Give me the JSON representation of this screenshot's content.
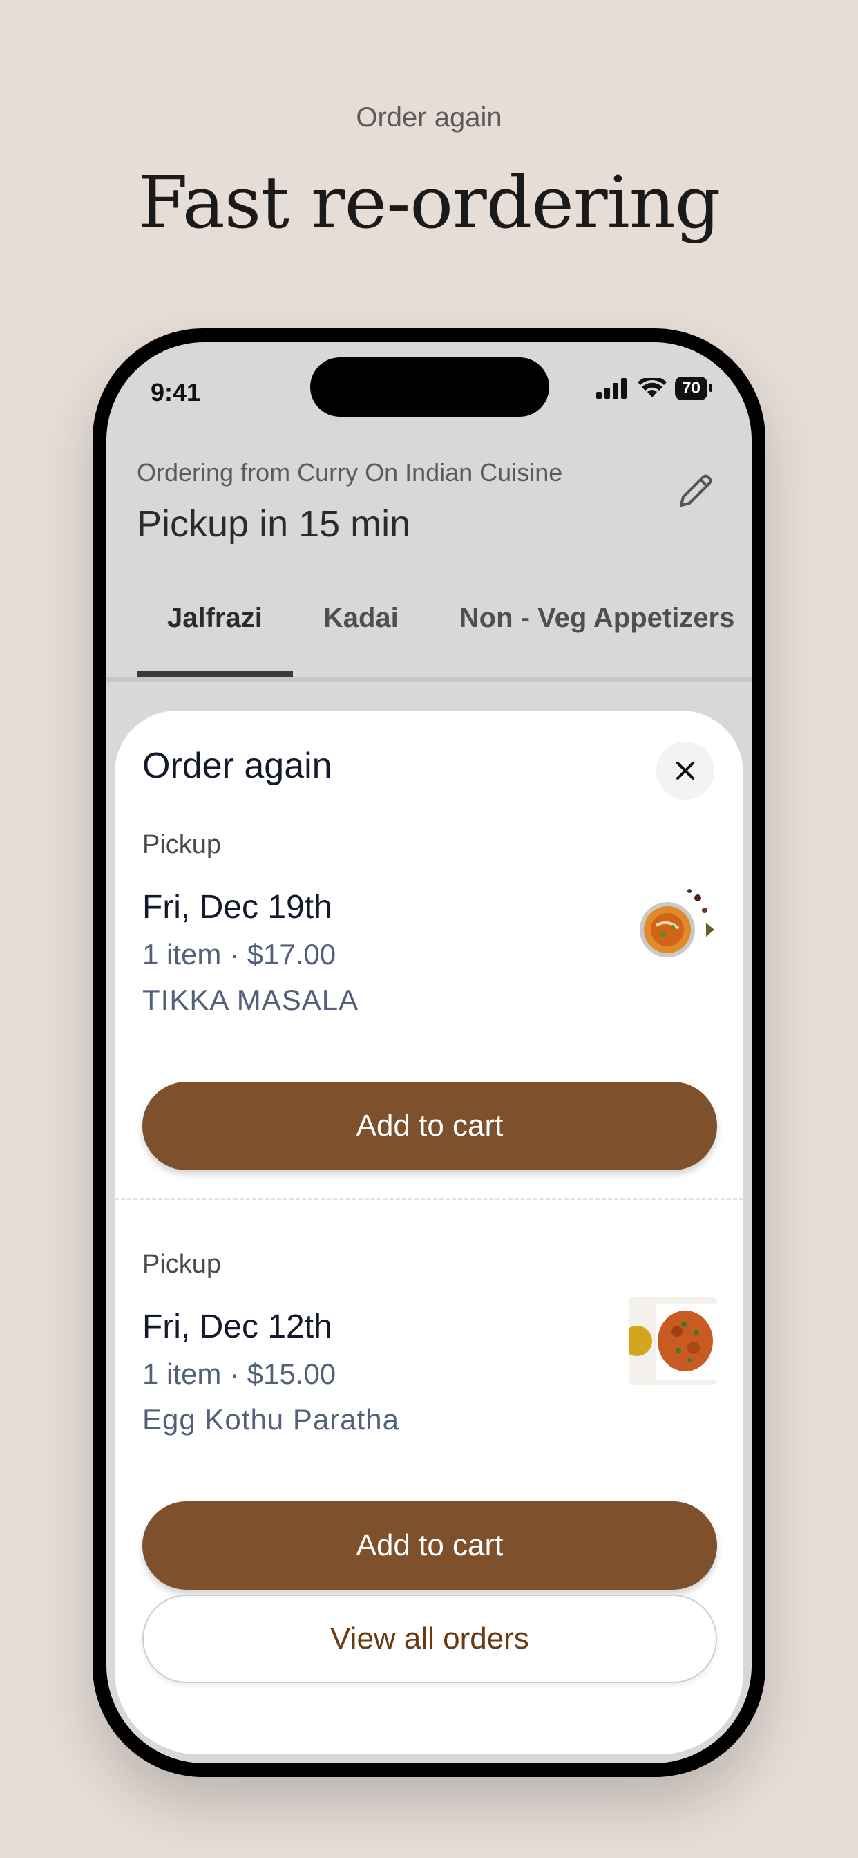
{
  "marketing": {
    "eyebrow": "Order again",
    "headline": "Fast re-ordering"
  },
  "status_bar": {
    "time": "9:41",
    "battery": "70"
  },
  "header": {
    "ordering_from": "Ordering from Curry On Indian Cuisine",
    "pickup_title": "Pickup in 15 min"
  },
  "tabs": [
    {
      "label": "Jalfrazi",
      "active": true
    },
    {
      "label": "Kadai",
      "active": false
    },
    {
      "label": "Non - Veg Appetizers",
      "active": false
    }
  ],
  "sheet": {
    "title": "Order again",
    "orders": [
      {
        "method": "Pickup",
        "date": "Fri, Dec 19th",
        "meta": "1 item · $17.00",
        "item": "TIKKA MASALA",
        "button": "Add to cart"
      },
      {
        "method": "Pickup",
        "date": "Fri, Dec 12th",
        "meta": "1 item · $15.00",
        "item": "Egg Kothu Paratha",
        "button": "Add to cart"
      }
    ],
    "view_all": "View all orders"
  },
  "colors": {
    "background": "#e6ddd7",
    "primary_button": "#7e512c",
    "link_text": "#6b3a10"
  }
}
